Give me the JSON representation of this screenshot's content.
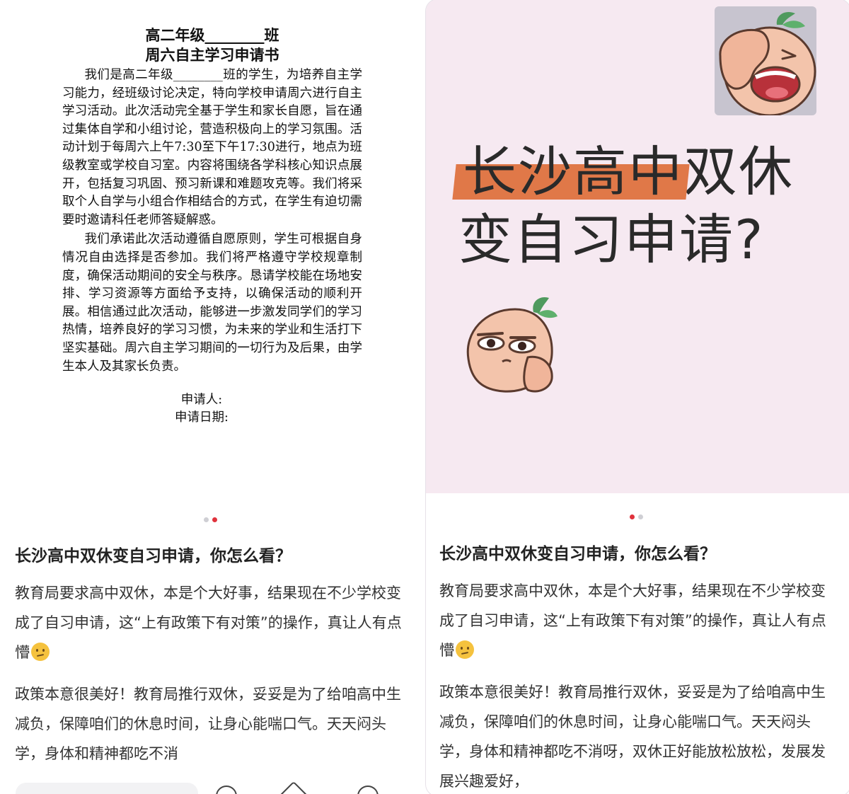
{
  "left_post": {
    "doc": {
      "title_line1": "高二年级________班",
      "title_line2": "周六自主学习申请书",
      "para1": "我们是高二年级________班的学生，为培养自主学习能力，经班级讨论决定，特向学校申请周六进行自主学习活动。此次活动完全基于学生和家长自愿，旨在通过集体自学和小组讨论，营造积极向上的学习氛围。活动计划于每周六上午7:30至下午17:30进行，地点为班级教室或学校自习室。内容将围绕各学科核心知识点展开，包括复习巩固、预习新课和难题攻克等。我们将采取个人自学与小组合作相结合的方式，在学生有迫切需要时邀请科任老师答疑解惑。",
      "para2": "我们承诺此次活动遵循自愿原则，学生可根据自身情况自由选择是否参加。我们将严格遵守学校规章制度，确保活动期间的安全与秩序。恳请学校能在场地安排、学习资源等方面给予支持，以确保活动的顺利开展。相信通过此次活动，能够进一步激发同学们的学习热情，培养良好的学习习惯，为未来的学业和生活打下坚实基础。周六自主学习期间的一切行为及后果，由学生本人及其家长负责。",
      "applicant_label": "申请人:",
      "date_label": "申请日期:"
    },
    "carousel_active_index": 2,
    "carousel_total": 2,
    "title": "长沙高中双休变自习申请，你怎么看？",
    "body_p1": "教育局要求高中双休，本是个大好事，结果现在不少学校变成了自习申请，这“上有政策下有对策”的操作，真让人有点懵",
    "body_p2": "政策本意很美好！教育局推行双休，妥妥是为了给咱高中生减负，保障咱们的休息时间，让身心能喘口气。天天闷头学，身体和精神都吃不消"
  },
  "right_post": {
    "hero_line1_highlight": "长沙高中",
    "hero_line1_rest": "双休",
    "hero_line2": "变自习申请?",
    "carousel_active_index": 1,
    "carousel_total": 2,
    "title": "长沙高中双休变自习申请，你怎么看？",
    "body_p1": "教育局要求高中双休，本是个大好事，结果现在不少学校变成了自习申请，这“上有政策下有对策”的操作，真让人有点懵",
    "body_p2": "政策本意很美好！教育局推行双休，妥妥是为了给咱高中生减负，保障咱们的休息时间，让身心能喘口气。天天闷头学，身体和精神都吃不消呀，双休正好能放松放松，发展发展兴趣爱好，"
  },
  "colors": {
    "hero_bg": "#f6e9f1",
    "highlight": "#e07848",
    "dot_active": "#e0323c",
    "dot_inactive": "#cfcfd4",
    "emoji": "#f5c23e"
  },
  "icons": [
    "confused-face-emoji",
    "facepalm-mascot",
    "chin-rest-mascot",
    "like-icon",
    "star-icon",
    "comment-icon"
  ]
}
